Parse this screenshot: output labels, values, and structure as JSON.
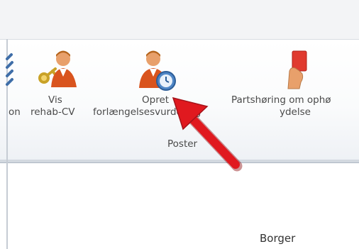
{
  "ribbon": {
    "buttons": [
      {
        "label_line1": "",
        "label_line2": "on",
        "icon": "document-icon"
      },
      {
        "label_line1": "Vis",
        "label_line2": "rehab-CV",
        "icon": "person-key-icon"
      },
      {
        "label_line1": "Opret",
        "label_line2": "forlængelsesvurdering",
        "icon": "person-clock-icon"
      },
      {
        "label_line1": "Partshøring om ophø",
        "label_line2": "ydelse",
        "icon": "red-card-icon"
      }
    ],
    "group_label": "Poster"
  },
  "content": {
    "section_label": "Borger"
  },
  "annotation": {
    "arrow_color": "#e0191f"
  }
}
